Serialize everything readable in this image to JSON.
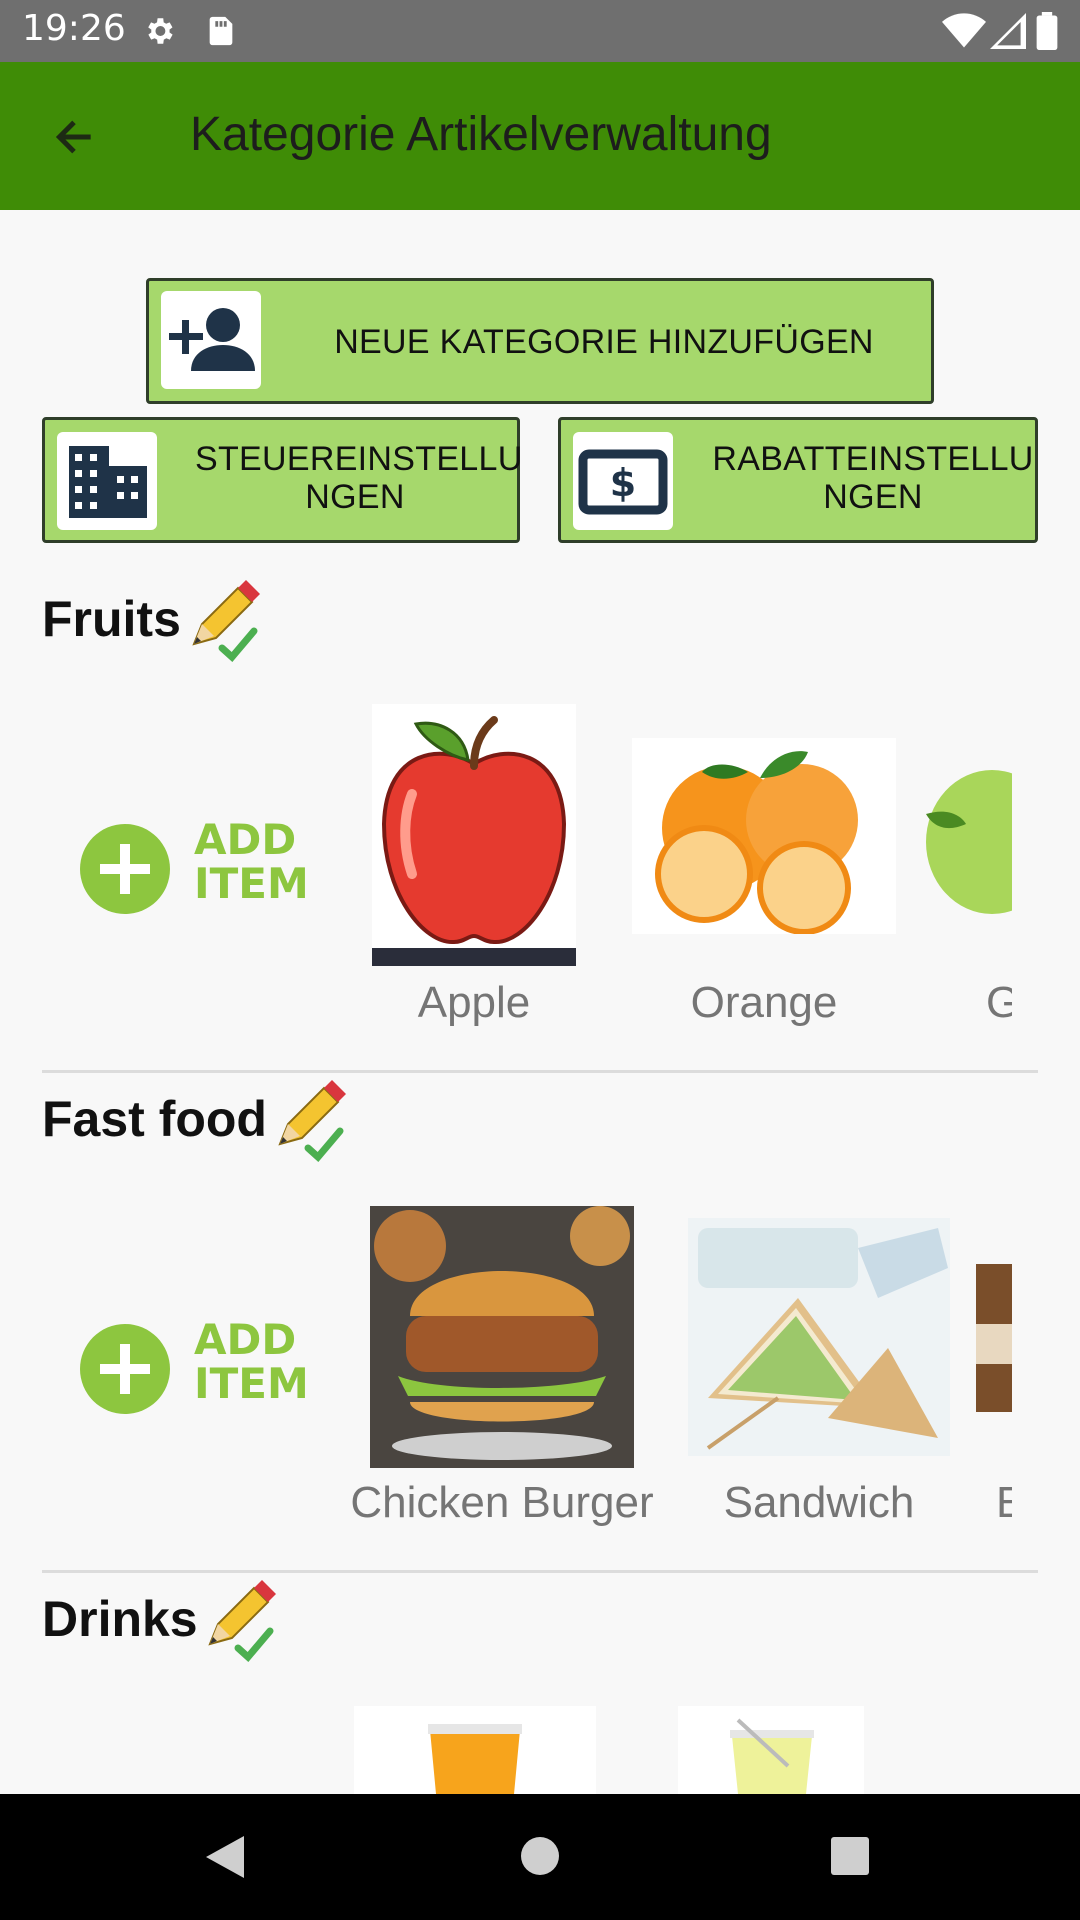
{
  "status_bar": {
    "time": "19:26",
    "icons": [
      "gear-icon",
      "sd-card-icon",
      "wifi-icon",
      "signal-icon",
      "battery-icon"
    ]
  },
  "app_bar": {
    "title": "Kategorie Artikelverwaltung",
    "back_icon": "arrow-back-icon",
    "color": "#3f8c06"
  },
  "actions": {
    "add_category_label": "NEUE KATEGORIE HINZUFÜGEN",
    "tax_settings_line1": "STEUEREINSTELLU",
    "tax_settings_line2": "NGEN",
    "discount_settings_line1": "RABATTEINSTELLU",
    "discount_settings_line2": "NGEN",
    "button_color": "#a6d86c"
  },
  "add_item": {
    "line1": "ADD",
    "line2": "ITEM",
    "color": "#8dc63f"
  },
  "categories": [
    {
      "name": "Fruits",
      "items": [
        {
          "label": "Apple"
        },
        {
          "label": "Orange"
        },
        {
          "label": "G"
        }
      ]
    },
    {
      "name": "Fast food",
      "items": [
        {
          "label": "Chicken Burger"
        },
        {
          "label": "Sandwich"
        },
        {
          "label": "E"
        }
      ]
    },
    {
      "name": "Drinks",
      "items": [
        {
          "label": ""
        },
        {
          "label": ""
        }
      ]
    }
  ],
  "nav_bar": {
    "icons": [
      "back-triangle-icon",
      "home-circle-icon",
      "recents-square-icon"
    ]
  }
}
